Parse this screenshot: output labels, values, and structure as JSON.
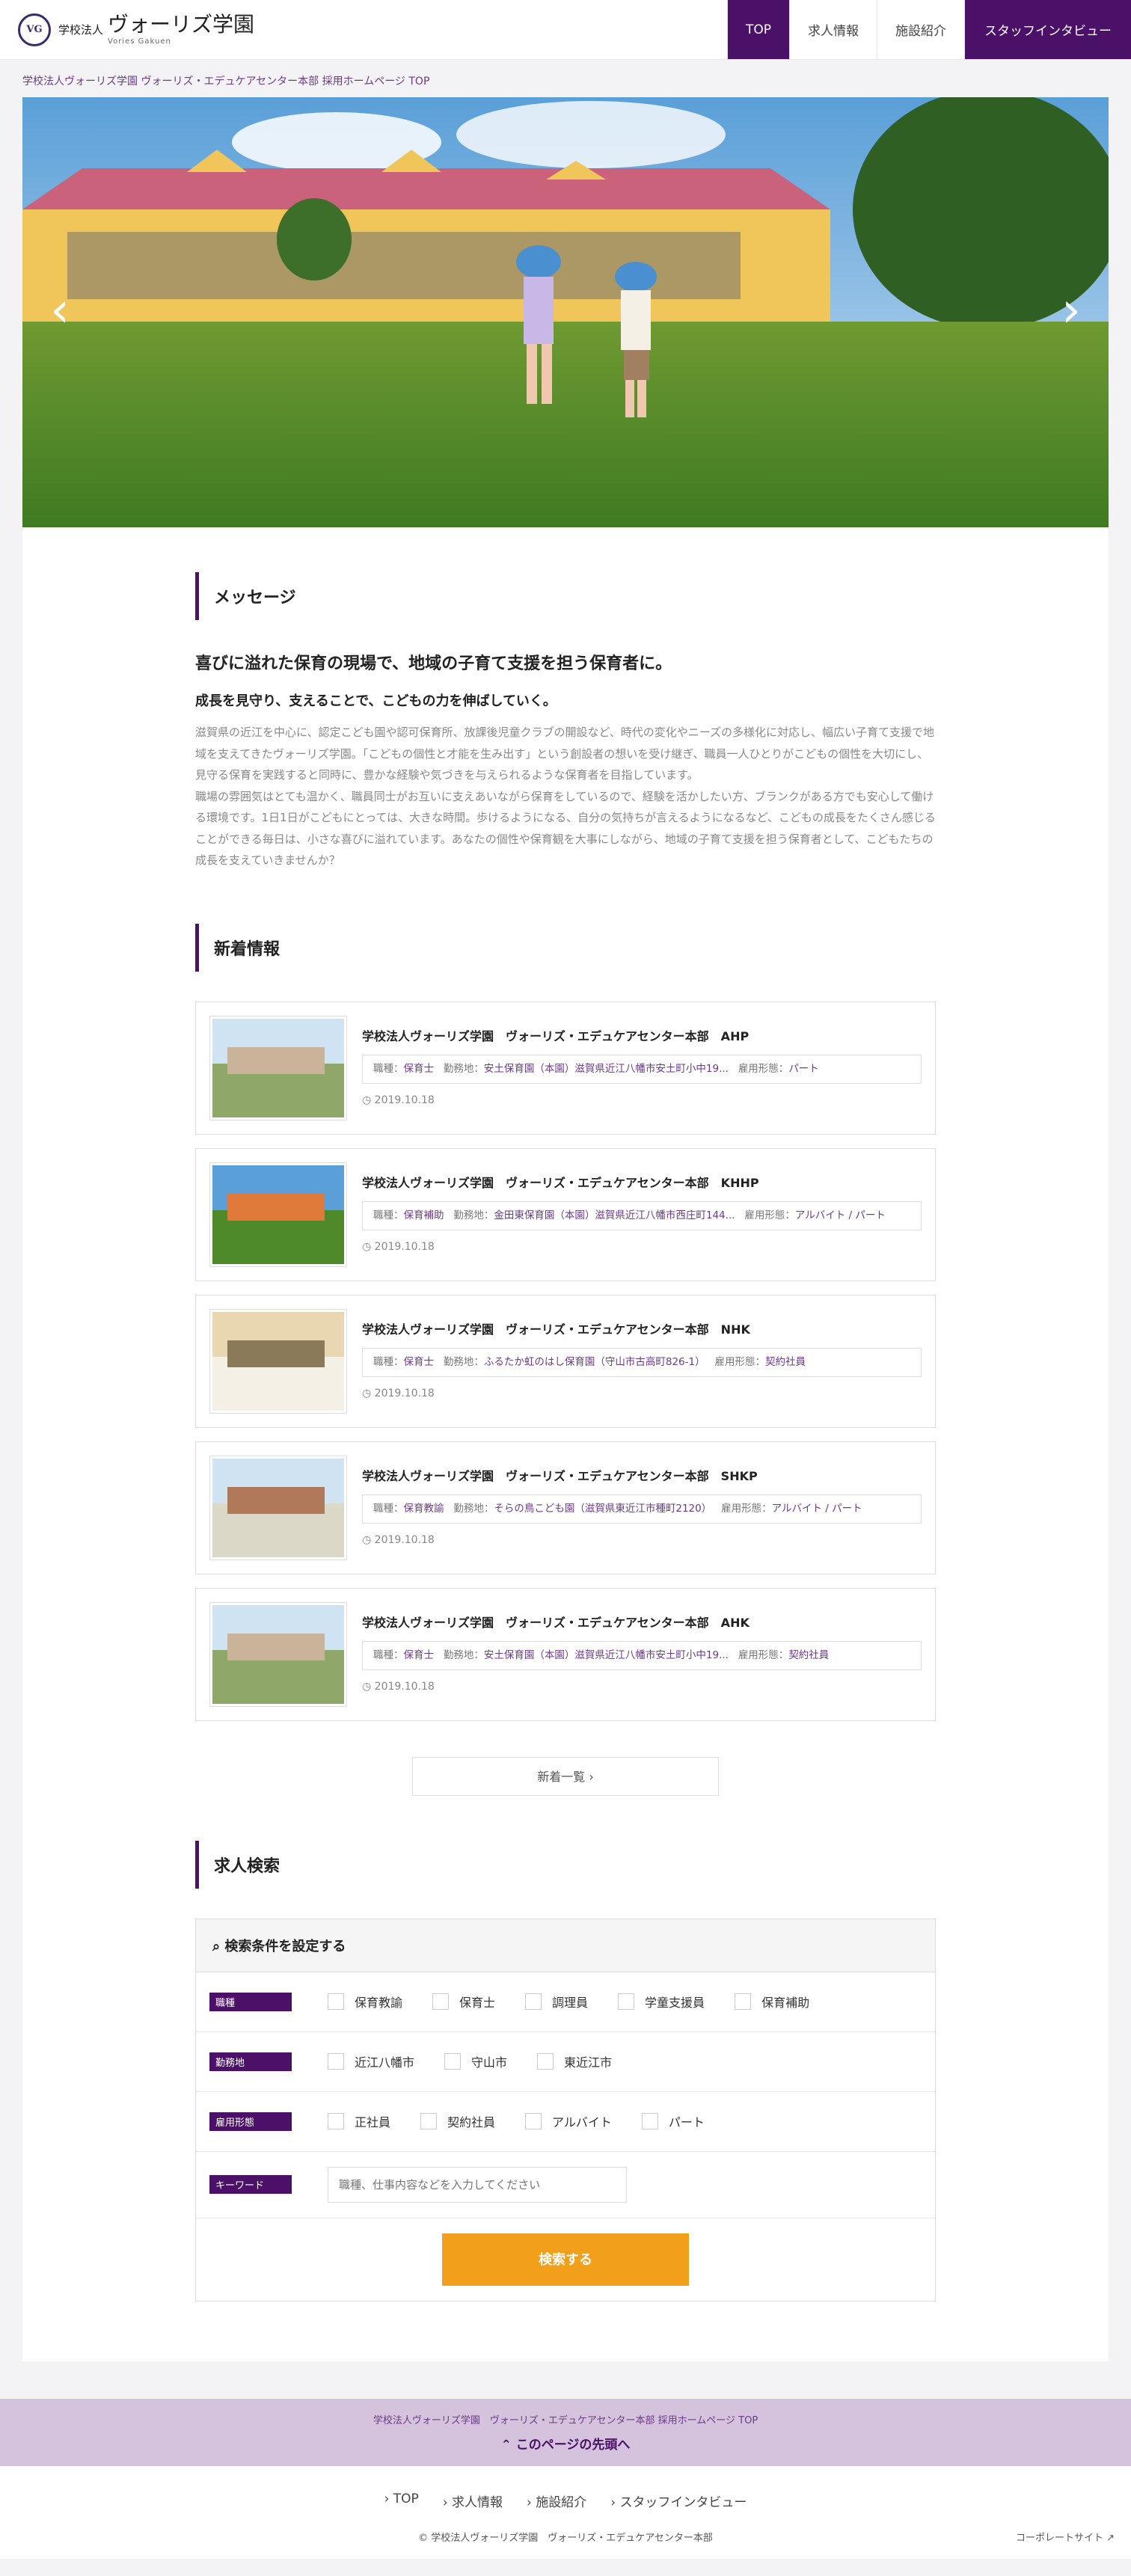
{
  "header": {
    "logo_mark": "VG",
    "logo_prefix": "学校法人",
    "logo_name": "ヴォーリズ学園",
    "logo_sub": "Vories Gakuen",
    "nav": [
      "TOP",
      "求人情報",
      "施設紹介",
      "スタッフインタビュー"
    ]
  },
  "breadcrumb": "学校法人ヴォーリズ学園 ヴォーリズ・エデュケアセンター本部 採用ホームページ TOP",
  "hero": {
    "prev": "‹",
    "next": "›"
  },
  "message": {
    "section_title": "メッセージ",
    "heading": "喜びに溢れた保育の現場で、地域の子育て支援を担う保育者に。",
    "subheading": "成長を見守り、支えることで、こどもの力を伸ばしていく。",
    "para1": "滋賀県の近江を中心に、認定こども園や認可保育所、放課後児童クラブの開設など、時代の変化やニーズの多様化に対応し、幅広い子育て支援で地域を支えてきたヴォーリズ学園。「こどもの個性と才能を生み出す」という創設者の想いを受け継ぎ、職員一人ひとりがこどもの個性を大切にし、見守る保育を実践すると同時に、豊かな経験や気づきを与えられるような保育者を目指しています。",
    "para2": "職場の雰囲気はとても温かく、職員同士がお互いに支えあいながら保育をしているので、経験を活かしたい方、ブランクがある方でも安心して働ける環境です。1日1日がこどもにとっては、大きな時間。歩けるようになる、自分の気持ちが言えるようになるなど、こどもの成長をたくさん感じることができる毎日は、小さな喜びに溢れています。あなたの個性や保育観を大事にしながら、地域の子育て支援を担う保育者として、こどもたちの成長を支えていきませんか？"
  },
  "news": {
    "section_title": "新着情報",
    "items": [
      {
        "title": "学校法人ヴォーリズ学園　ヴォーリズ・エデュケアセンター本部　AHP",
        "meta_job_label": "職種：",
        "meta_job": "保育士",
        "meta_loc_label": "勤務地：",
        "meta_loc": "安土保育園（本園）滋賀県近江八幡市安土町小中19...",
        "meta_emp_label": "雇用形態：",
        "meta_emp": "パート",
        "date": "2019.10.18"
      },
      {
        "title": "学校法人ヴォーリズ学園　ヴォーリズ・エデュケアセンター本部　KHHP",
        "meta_job_label": "職種：",
        "meta_job": "保育補助",
        "meta_loc_label": "勤務地：",
        "meta_loc": "金田東保育園（本園）滋賀県近江八幡市西庄町144...",
        "meta_emp_label": "雇用形態：",
        "meta_emp": "アルバイト / パート",
        "date": "2019.10.18"
      },
      {
        "title": "学校法人ヴォーリズ学園　ヴォーリズ・エデュケアセンター本部　NHK",
        "meta_job_label": "職種：",
        "meta_job": "保育士",
        "meta_loc_label": "勤務地：",
        "meta_loc": "ふるたか虹のはし保育園（守山市古高町826-1）",
        "meta_emp_label": "雇用形態：",
        "meta_emp": "契約社員",
        "date": "2019.10.18"
      },
      {
        "title": "学校法人ヴォーリズ学園　ヴォーリズ・エデュケアセンター本部　SHKP",
        "meta_job_label": "職種：",
        "meta_job": "保育教諭",
        "meta_loc_label": "勤務地：",
        "meta_loc": "そらの鳥こども園（滋賀県東近江市種町2120）",
        "meta_emp_label": "雇用形態：",
        "meta_emp": "アルバイト / パート",
        "date": "2019.10.18"
      },
      {
        "title": "学校法人ヴォーリズ学園　ヴォーリズ・エデュケアセンター本部　AHK",
        "meta_job_label": "職種：",
        "meta_job": "保育士",
        "meta_loc_label": "勤務地：",
        "meta_loc": "安土保育園（本園）滋賀県近江八幡市安土町小中19...",
        "meta_emp_label": "雇用形態：",
        "meta_emp": "契約社員",
        "date": "2019.10.18"
      }
    ],
    "more": "新着一覧"
  },
  "search": {
    "section_title": "求人検索",
    "head": "検索条件を設定する",
    "rows": [
      {
        "tag": "職種",
        "options": [
          "保育教諭",
          "保育士",
          "調理員",
          "学童支援員",
          "保育補助"
        ]
      },
      {
        "tag": "勤務地",
        "options": [
          "近江八幡市",
          "守山市",
          "東近江市"
        ]
      },
      {
        "tag": "雇用形態",
        "options": [
          "正社員",
          "契約社員",
          "アルバイト",
          "パート"
        ]
      }
    ],
    "keyword_tag": "キーワード",
    "keyword_placeholder": "職種、仕事内容などを入力してください",
    "submit": "検索する"
  },
  "footer": {
    "band_text": "学校法人ヴォーリズ学園　ヴォーリズ・エデュケアセンター本部 採用ホームページ TOP",
    "to_top": "このページの先頭へ",
    "nav": [
      "TOP",
      "求人情報",
      "施設紹介",
      "スタッフインタビュー"
    ],
    "copyright": "© 学校法人ヴォーリズ学園　ヴォーリズ・エデュケアセンター本部",
    "corporate": "コーポレートサイト"
  }
}
